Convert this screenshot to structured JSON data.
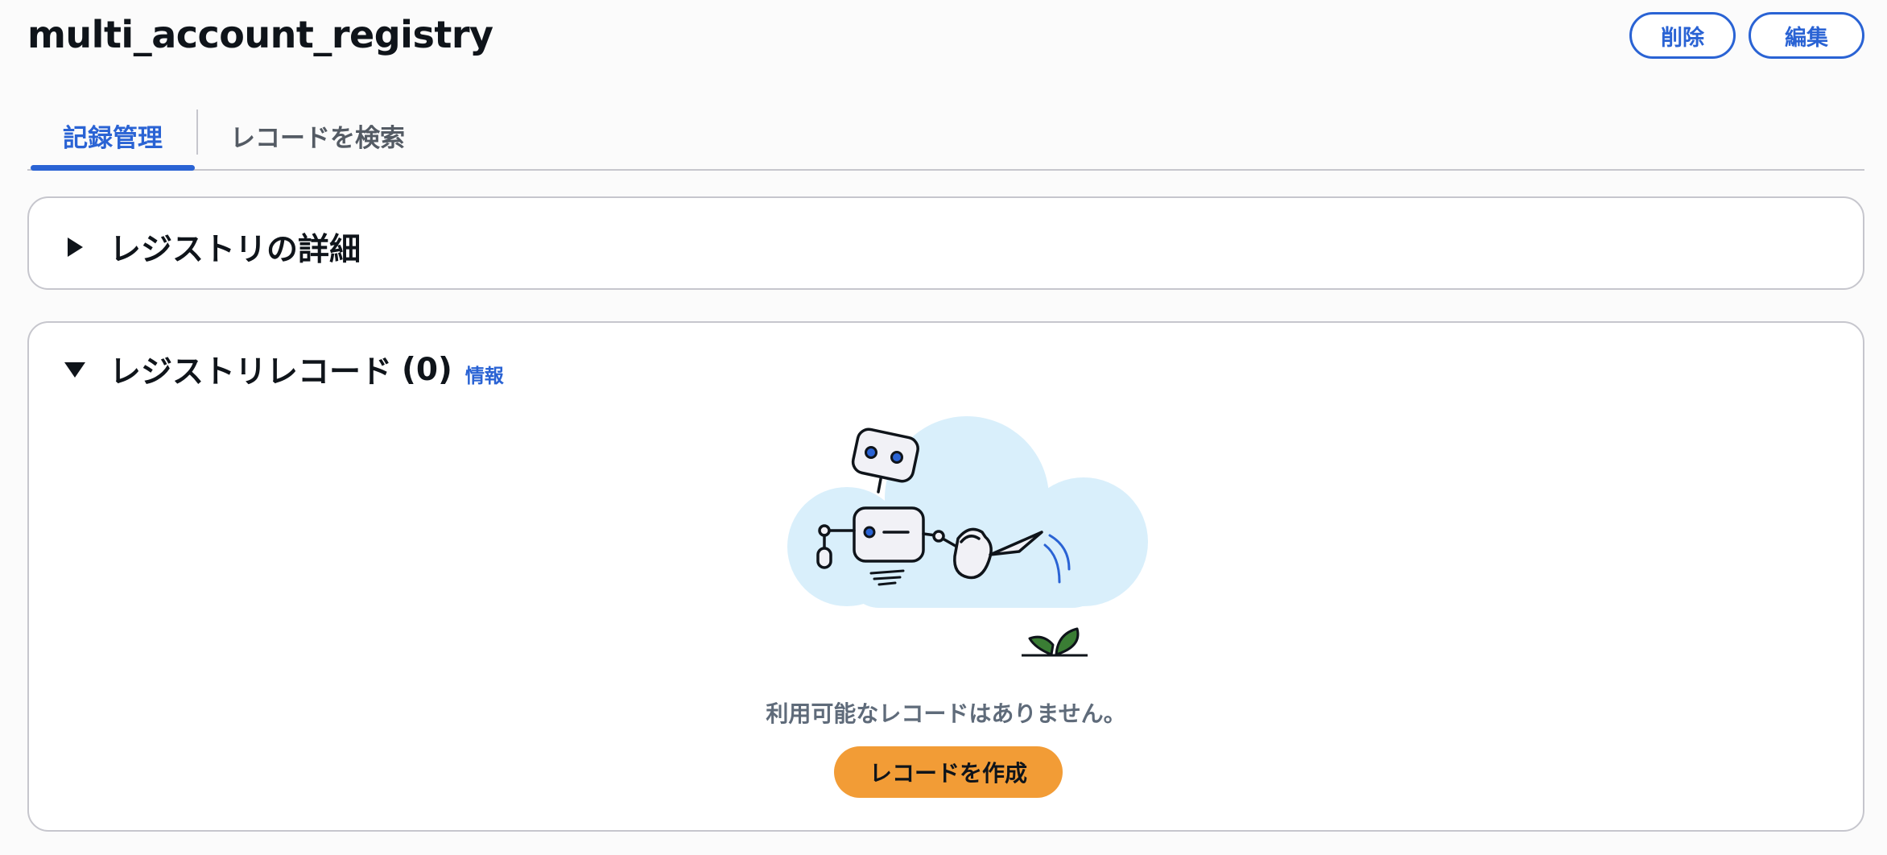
{
  "header": {
    "title": "multi_account_registry",
    "delete_label": "削除",
    "edit_label": "編集"
  },
  "tabs": [
    {
      "label": "記録管理",
      "active": true
    },
    {
      "label": "レコードを検索",
      "active": false
    }
  ],
  "details_panel": {
    "title": "レジストリの詳細",
    "expanded": false
  },
  "records_panel": {
    "title": "レジストリレコード",
    "count": "(0)",
    "info_label": "情報",
    "expanded": true,
    "empty_message": "利用可能なレコードはありません。",
    "create_button_label": "レコードを作成"
  },
  "colors": {
    "accent": "#2a63d4",
    "primary_button": "#f29c36",
    "cloud": "#d9effb",
    "leaf": "#3a7d34"
  },
  "icons": {
    "collapsed_caret": "caret-right-icon",
    "expanded_caret": "caret-down-icon",
    "empty_state": "robot-watering-plant-illustration"
  }
}
